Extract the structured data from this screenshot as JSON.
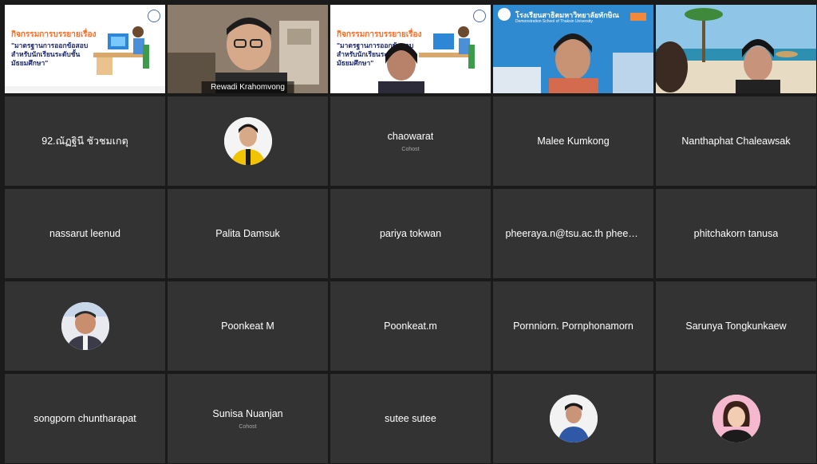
{
  "participants": [
    {
      "name": "",
      "type": "video",
      "video": "poster",
      "poster": {
        "title": "กิจกรรมการบรรยายเรื่อง",
        "body": "\"มาตรฐานการออกข้อสอบ สำหรับนักเรียนระดับชั้น มัธยมศึกษา\""
      }
    },
    {
      "name": "Rewadi Krahomvong",
      "type": "video",
      "video": "room",
      "active": true
    },
    {
      "name": "",
      "type": "video",
      "video": "poster2",
      "poster": {
        "title": "กิจกรรมการบรรยายเรื่อง",
        "body": "\"มาตรฐานการออกข้อสอบ สำหรับนักเรียนระดับชั้น มัธยมศึกษา\""
      }
    },
    {
      "name": "",
      "type": "video",
      "video": "school",
      "school_name": "โรงเรียนสาธิตมหาวิทยาลัยทักษิณ",
      "school_sub": "Demonstration School of Thaksin University"
    },
    {
      "name": "",
      "type": "video",
      "video": "beach"
    },
    {
      "name": "92.ณัฏฐินี ชัวชมเกตุ",
      "type": "name"
    },
    {
      "name": "",
      "type": "avatar",
      "avatar": "man-yellow"
    },
    {
      "name": "chaowarat",
      "type": "name",
      "cohost": "Cohost"
    },
    {
      "name": "Malee Kumkong",
      "type": "name"
    },
    {
      "name": "Nanthaphat Chaleawsak",
      "type": "name"
    },
    {
      "name": "nassarut leenud",
      "type": "name"
    },
    {
      "name": "Palita Damsuk",
      "type": "name"
    },
    {
      "name": "pariya tokwan",
      "type": "name"
    },
    {
      "name": "pheeraya.n@tsu.ac.th pheeraya.n@tsu.ac.th",
      "type": "name"
    },
    {
      "name": "phitchakorn tanusa",
      "type": "name"
    },
    {
      "name": "",
      "type": "avatar",
      "avatar": "man-suit"
    },
    {
      "name": "Poonkeat M",
      "type": "name"
    },
    {
      "name": "Poonkeat.m",
      "type": "name"
    },
    {
      "name": "Pornniorn. Pornphonamorn",
      "type": "name"
    },
    {
      "name": "Sarunya Tongkunkaew",
      "type": "name"
    },
    {
      "name": "songporn chuntharapat",
      "type": "name"
    },
    {
      "name": "Sunisa Nuanjan",
      "type": "name",
      "cohost": "Cohost"
    },
    {
      "name": "sutee sutee",
      "type": "name"
    },
    {
      "name": "",
      "type": "avatar",
      "avatar": "man-blue"
    },
    {
      "name": "",
      "type": "avatar",
      "avatar": "woman"
    }
  ],
  "colors": {
    "tile": "#333333",
    "active_border": "#5ac7ff",
    "poster_title": "#ff6a21",
    "poster_body": "#1e2a6e"
  }
}
